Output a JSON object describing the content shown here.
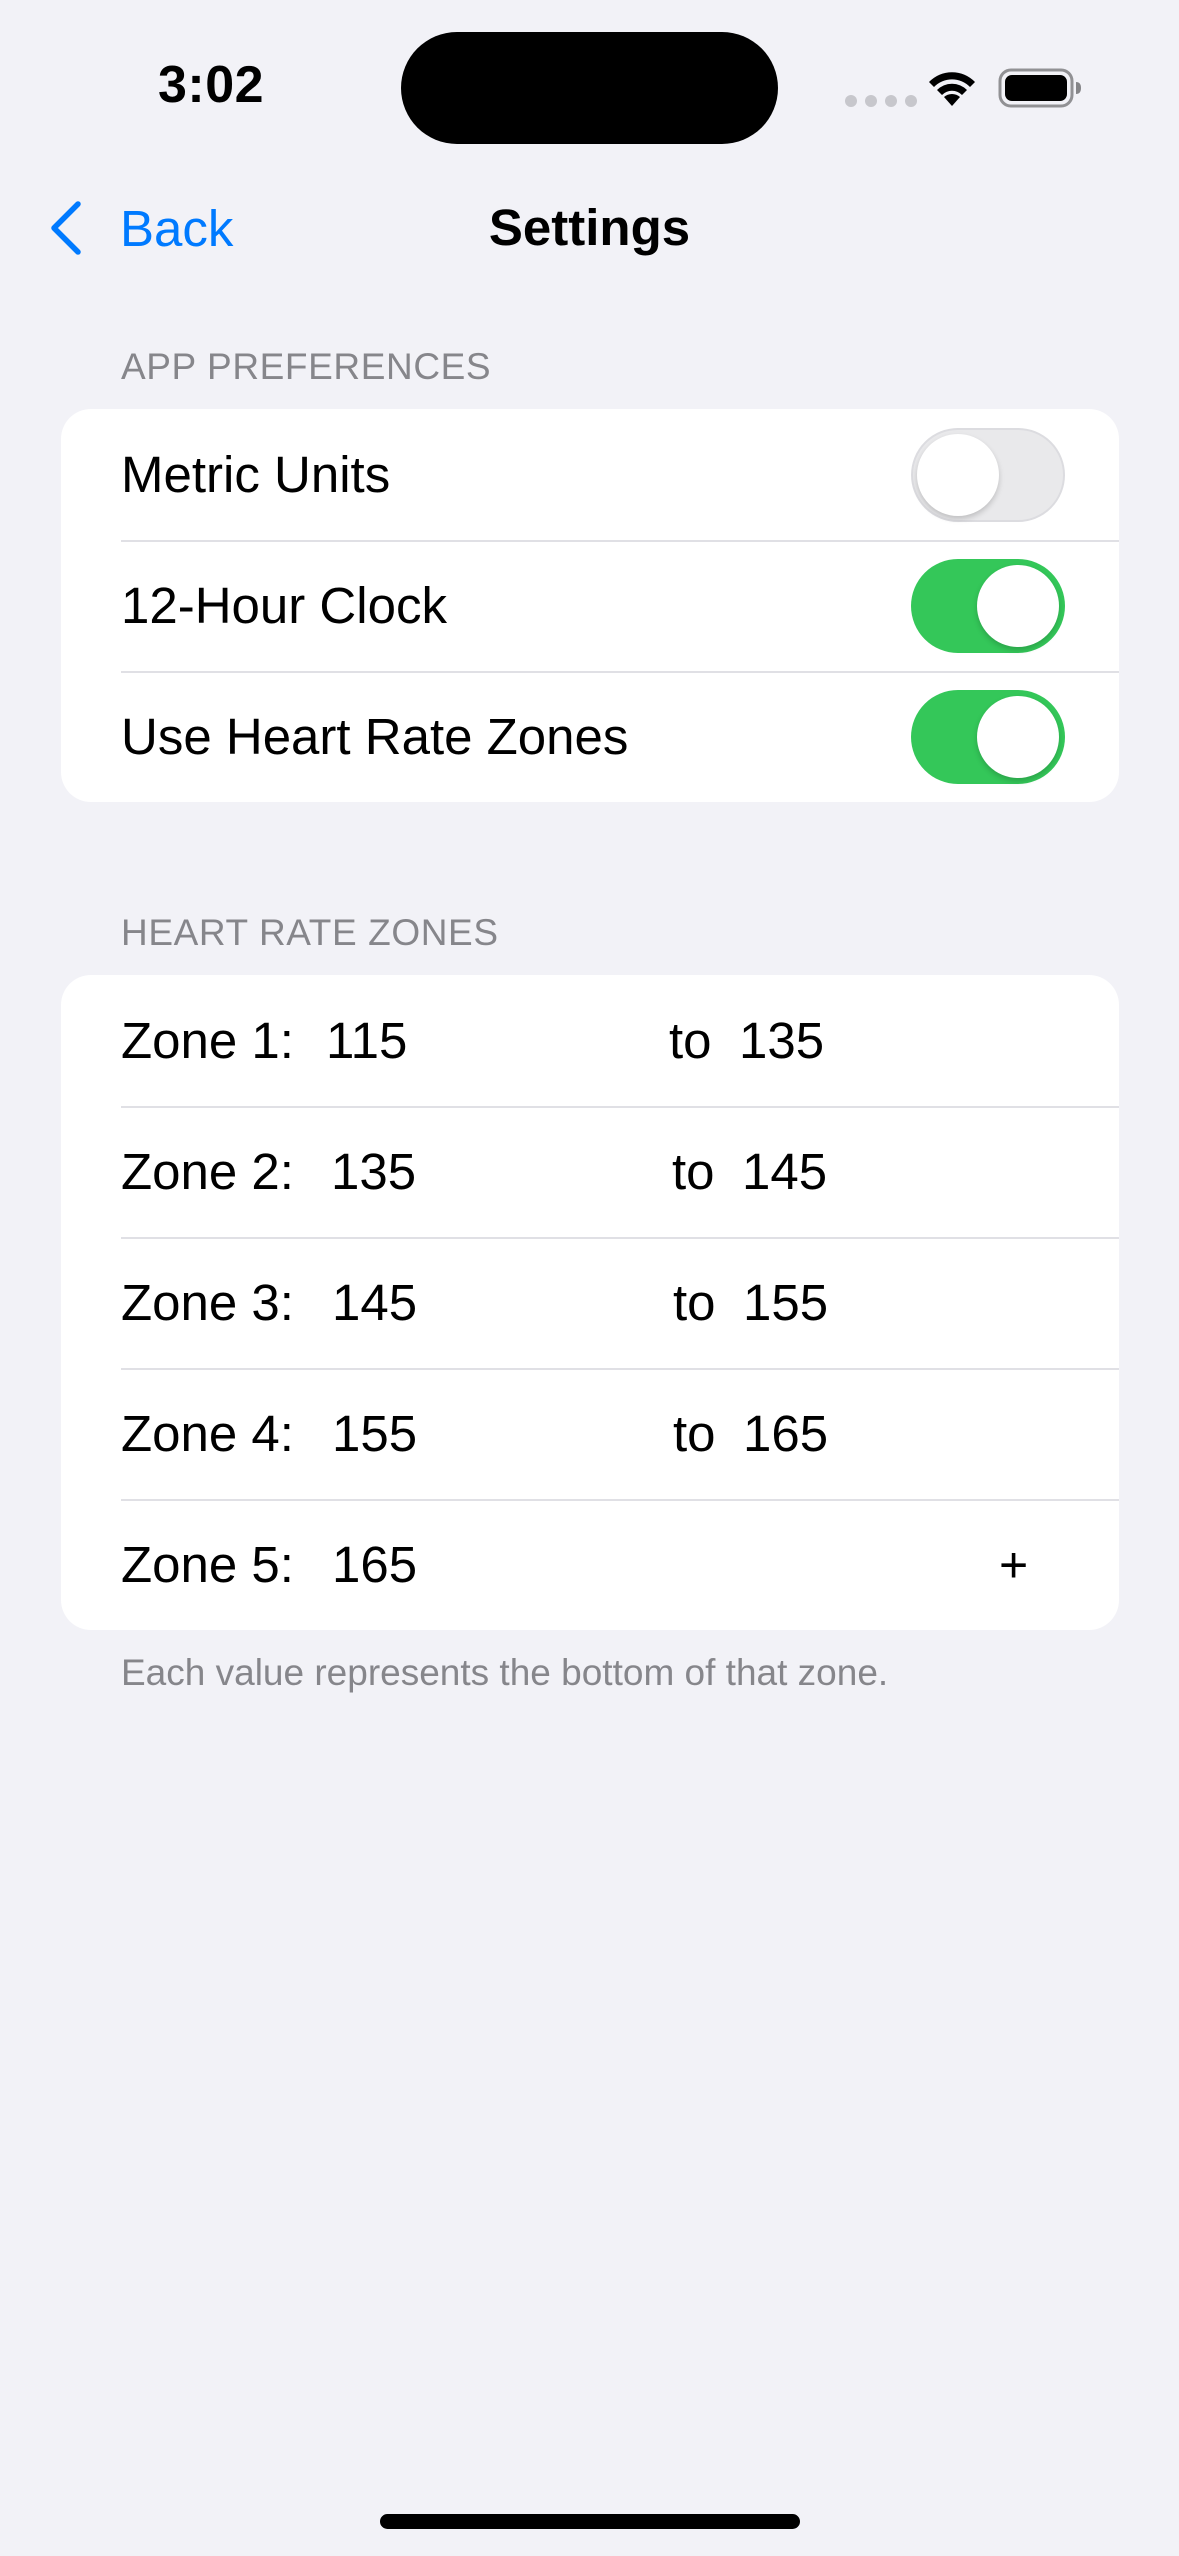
{
  "status_bar": {
    "time": "3:02"
  },
  "nav": {
    "back_label": "Back",
    "title": "Settings"
  },
  "app_preferences": {
    "header": "APP PREFERENCES",
    "items": [
      {
        "label": "Metric Units",
        "enabled": false
      },
      {
        "label": "12-Hour Clock",
        "enabled": true
      },
      {
        "label": "Use Heart Rate Zones",
        "enabled": true
      }
    ]
  },
  "heart_rate_zones": {
    "header": "HEART RATE ZONES",
    "to_label": "to",
    "zones": [
      {
        "label": "Zone 1:",
        "low": "115",
        "high": "135"
      },
      {
        "label": "Zone 2:",
        "low": "135",
        "high": "145"
      },
      {
        "label": "Zone 3:",
        "low": "145",
        "high": "155"
      },
      {
        "label": "Zone 4:",
        "low": "155",
        "high": "165"
      },
      {
        "label": "Zone 5:",
        "low": "165"
      }
    ],
    "add_label": "+",
    "footer": "Each value represents the bottom of that zone."
  },
  "colors": {
    "accent": "#007aff",
    "toggle_on": "#34c759",
    "background": "#f2f2f7"
  }
}
